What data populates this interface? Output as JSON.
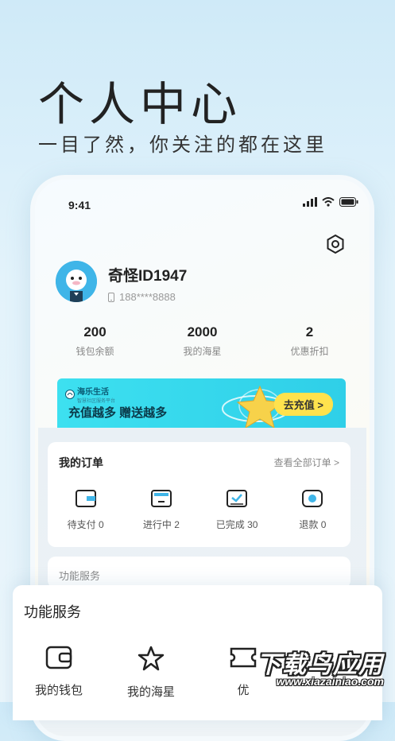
{
  "hero": {
    "title": "个人中心",
    "subtitle": "一目了然，你关注的都在这里"
  },
  "status_bar": {
    "time": "9:41"
  },
  "profile": {
    "name": "奇怪ID1947",
    "phone": "188****8888"
  },
  "stats": [
    {
      "value": "200",
      "label": "钱包余额"
    },
    {
      "value": "2000",
      "label": "我的海星"
    },
    {
      "value": "2",
      "label": "优惠折扣"
    }
  ],
  "banner": {
    "logo": "海乐生活",
    "logo_sub": "智慧社区服务平台",
    "text": "充值越多 赠送越多",
    "button": "去充值 >"
  },
  "orders": {
    "title": "我的订单",
    "view_all": "查看全部订单 >",
    "items": [
      {
        "label": "待支付 0",
        "icon": "wallet-pending-icon"
      },
      {
        "label": "进行中 2",
        "icon": "in-progress-icon"
      },
      {
        "label": "已完成 30",
        "icon": "completed-icon"
      },
      {
        "label": "退款 0",
        "icon": "refund-icon"
      }
    ]
  },
  "services_ghost": {
    "title": "功能服务"
  },
  "services": {
    "title": "功能服务",
    "items": [
      {
        "label": "我的钱包",
        "icon": "wallet-icon"
      },
      {
        "label": "我的海星",
        "icon": "star-icon"
      },
      {
        "label": "优",
        "icon": "coupon-icon"
      }
    ]
  },
  "watermark": {
    "main": "下载鸟应用",
    "url": "www.xiazainiao.com"
  },
  "colors": {
    "accent": "#3fb5e8",
    "banner": "#3de0f0",
    "button": "#ffe24d"
  }
}
